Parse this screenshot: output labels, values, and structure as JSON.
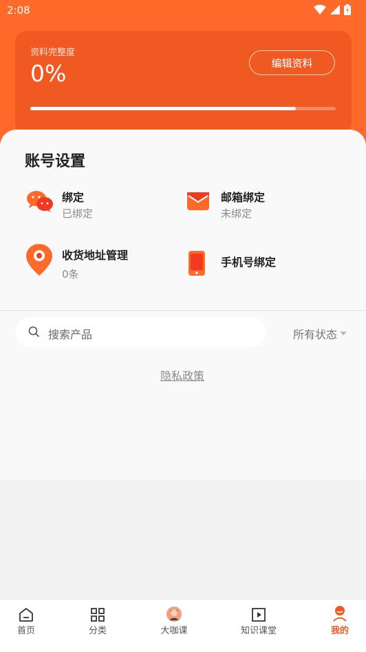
{
  "status_bar": {
    "time": "2:08"
  },
  "profile": {
    "completeness_label": "资料完整度",
    "completeness_value": "0%",
    "edit_button": "编辑资料",
    "progress_fraction": 0.87
  },
  "account": {
    "title": "账号设置",
    "items": [
      {
        "title": "绑定",
        "subtitle": "已绑定"
      },
      {
        "title": "邮箱绑定",
        "subtitle": "未绑定"
      },
      {
        "title": "收货地址管理",
        "subtitle": "0条"
      },
      {
        "title": "手机号绑定",
        "subtitle": ""
      }
    ]
  },
  "search": {
    "placeholder": "搜索产品"
  },
  "filter": {
    "label": "所有状态"
  },
  "privacy_link": "隐私政策",
  "tabs": [
    {
      "label": "首页",
      "icon": "home-icon"
    },
    {
      "label": "分类",
      "icon": "grid-icon"
    },
    {
      "label": "大咖课",
      "icon": "avatar-icon"
    },
    {
      "label": "知识课堂",
      "icon": "play-icon"
    },
    {
      "label": "我的",
      "icon": "profile-icon",
      "active": true
    }
  ],
  "colors": {
    "accent": "#ff6a2b",
    "card": "#f05a22"
  }
}
